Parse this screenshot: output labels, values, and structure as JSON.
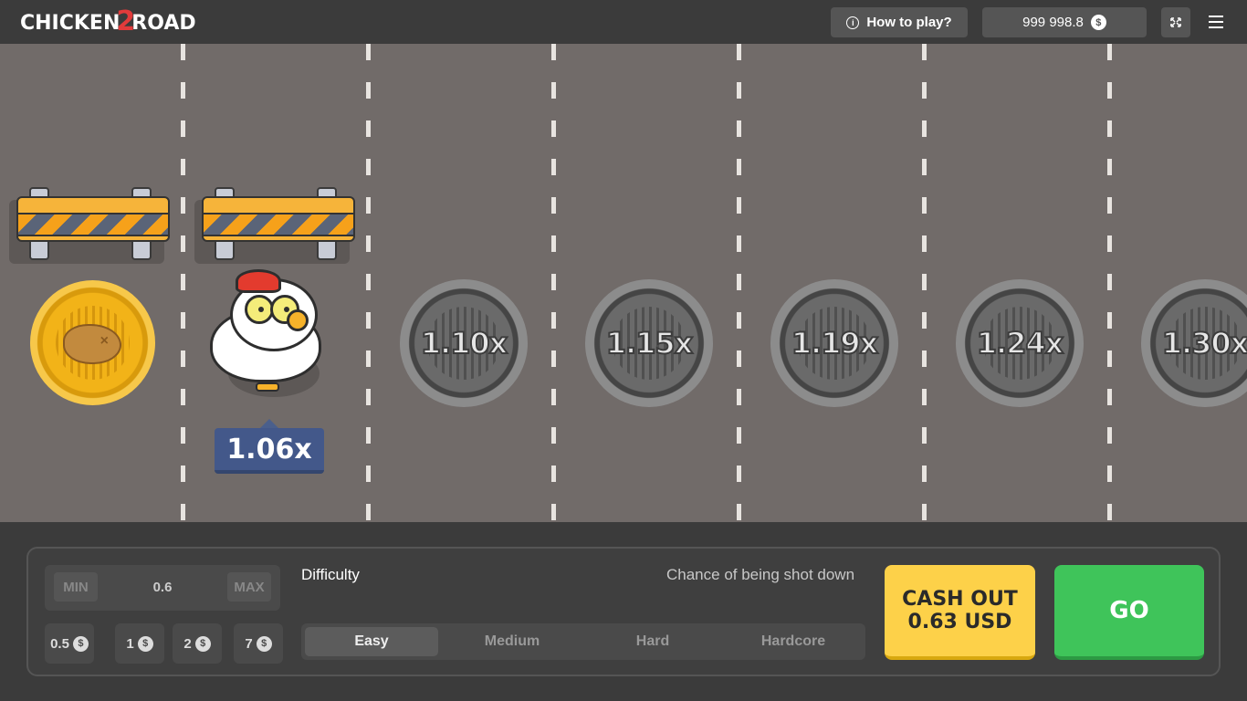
{
  "header": {
    "logo_left": "CHICKEN",
    "logo_num": "2",
    "logo_right": "ROAD",
    "how_to_play": "How to play?",
    "balance": "999 998.8",
    "currency_symbol": "$"
  },
  "road": {
    "current_multiplier": "1.06x",
    "upcoming": [
      "1.10x",
      "1.15x",
      "1.19x",
      "1.24x",
      "1.30x"
    ]
  },
  "bet": {
    "min_label": "MIN",
    "max_label": "MAX",
    "value": "0.6",
    "quick_amounts": [
      "0.5",
      "1",
      "2",
      "7"
    ]
  },
  "difficulty": {
    "label": "Difficulty",
    "chance_label": "Chance of being shot down",
    "options": [
      "Easy",
      "Medium",
      "Hard",
      "Hardcore"
    ],
    "selected": "Easy"
  },
  "actions": {
    "cashout_line1": "CASH OUT",
    "cashout_line2": "0.63 USD",
    "go": "GO"
  },
  "colors": {
    "road": "#716b69",
    "cashout": "#fdd149",
    "go": "#3fc45a",
    "multiplier_tag": "#43588a"
  }
}
